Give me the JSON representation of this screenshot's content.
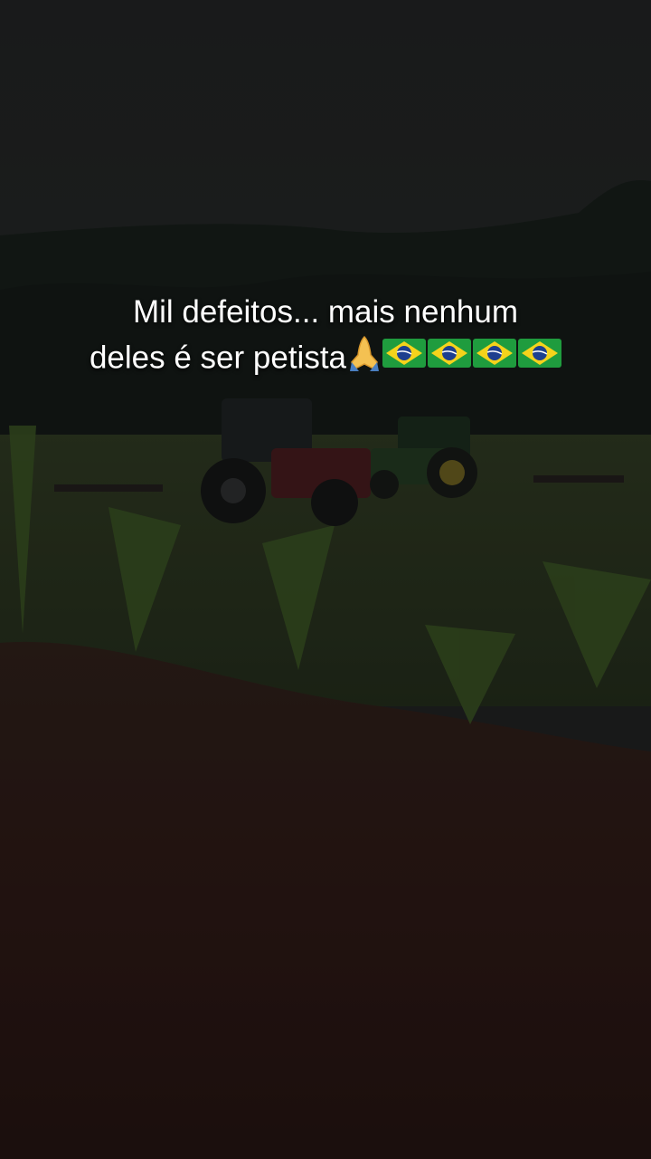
{
  "caption": {
    "line1": "Mil defeitos... mais nenhum",
    "line2": "deles é ser petista"
  },
  "icons": {
    "pray": "praying-hands-emoji",
    "flag": "brazil-flag-emoji"
  },
  "colors": {
    "sky": "#2b2d2e",
    "forest": "#1c2521",
    "crops": "#3f5a2a",
    "soil": "#3a211d",
    "flag_green": "#1f9c3e",
    "flag_yellow": "#f5d31b",
    "flag_blue": "#1d3f8f"
  }
}
